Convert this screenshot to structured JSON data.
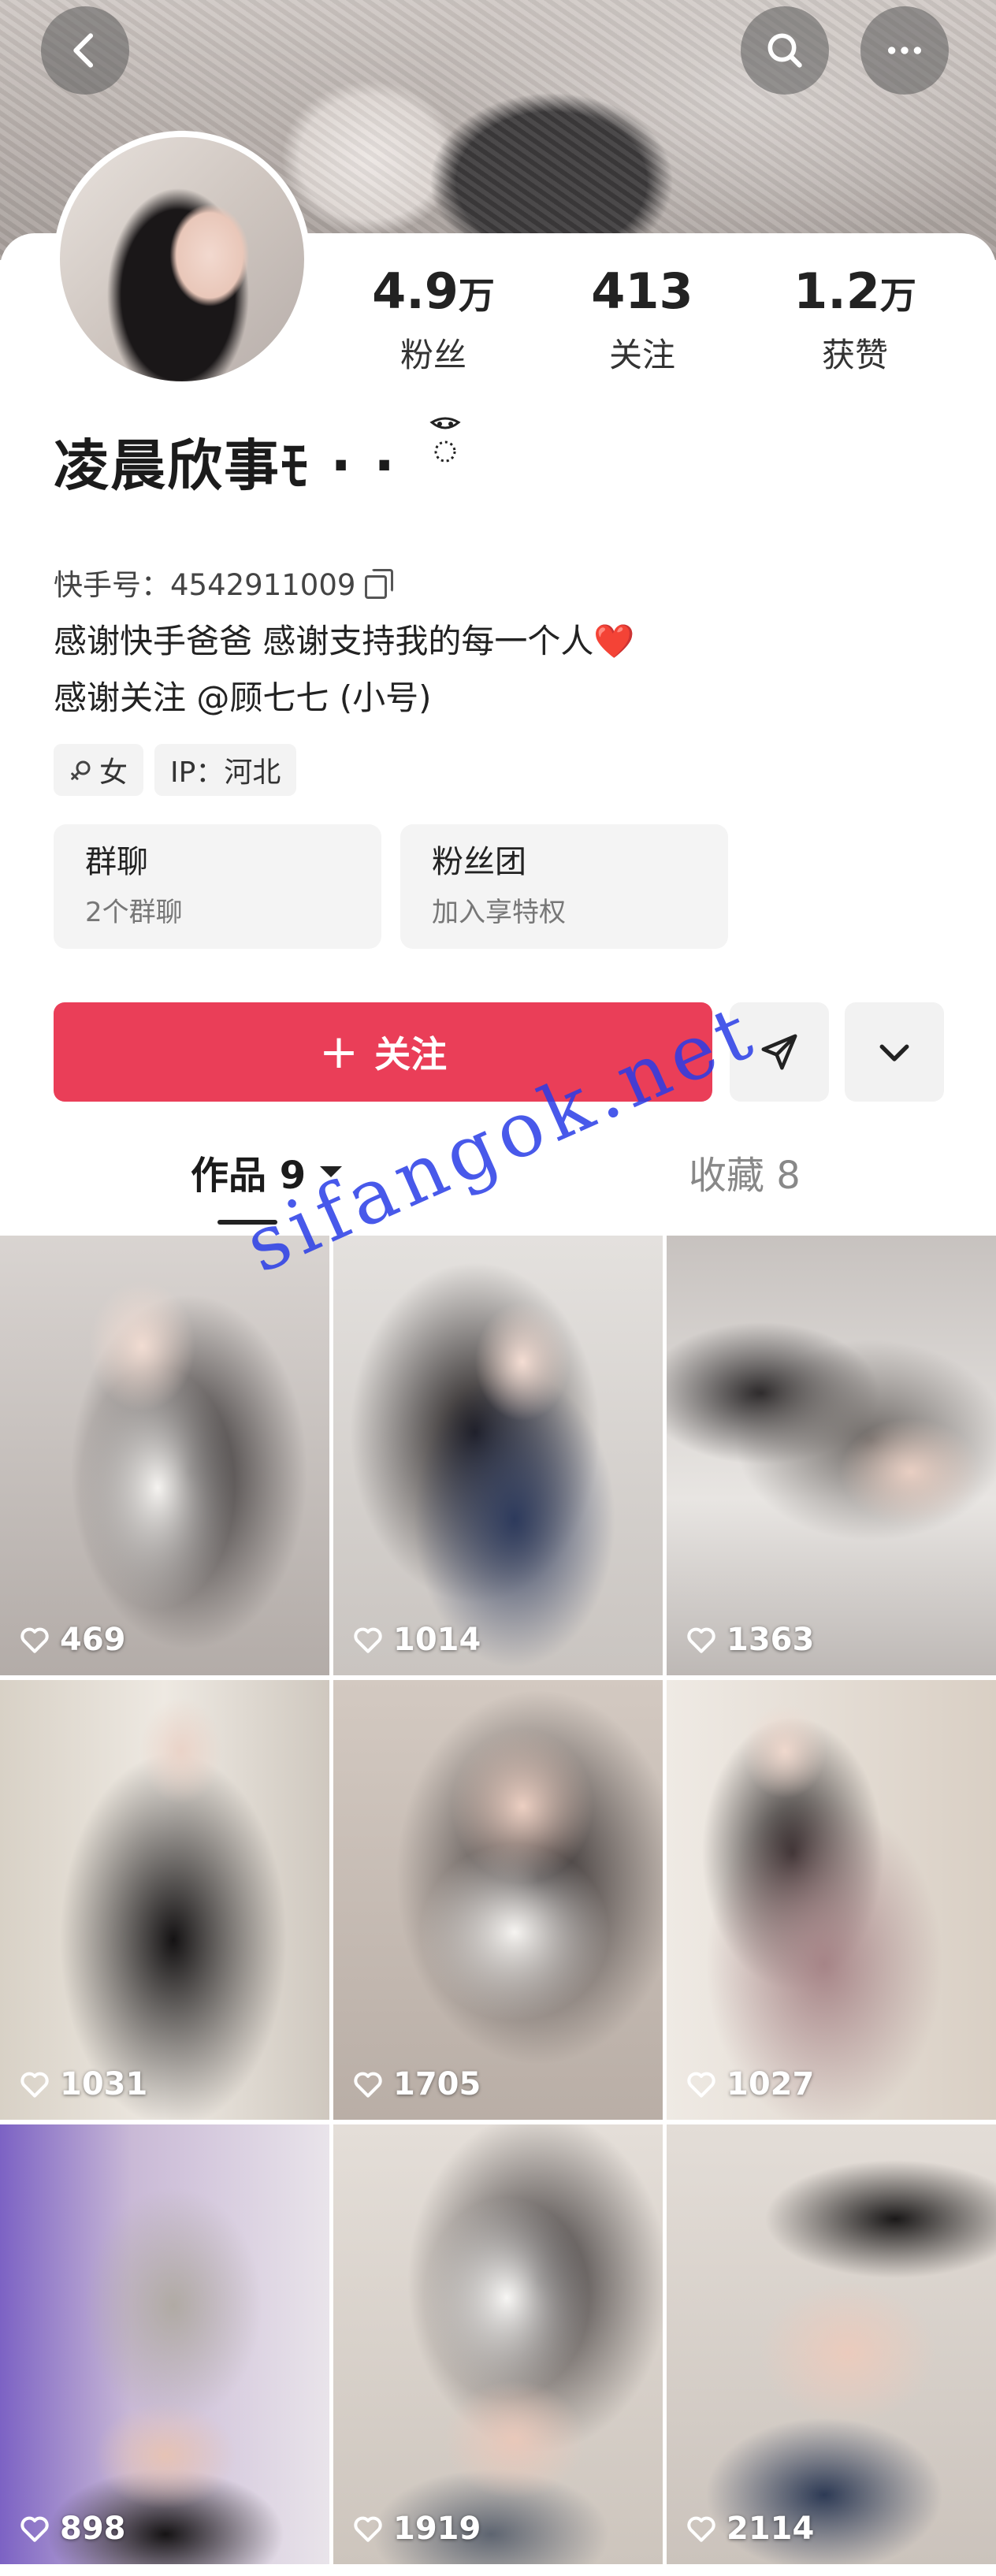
{
  "header": {
    "back_icon": "back-chevron-icon",
    "search_icon": "search-icon",
    "more_icon": "more-dots-icon"
  },
  "profile": {
    "name": "凌晨欣事ﾓ · ·",
    "kuaishou_id": "快手号：4542911009",
    "bio_line1": "感谢快手爸爸 感谢支持我的每一个人",
    "bio_heart": "❤️",
    "bio_line2": "感谢关注 @顾七七 (小号)"
  },
  "stats": [
    {
      "value": "4.9",
      "unit": "万",
      "label": "粉丝"
    },
    {
      "value": "413",
      "unit": "",
      "label": "关注"
    },
    {
      "value": "1.2",
      "unit": "万",
      "label": "获赞"
    }
  ],
  "tags": {
    "gender_icon": "female-icon",
    "gender": "女",
    "ip": "IP：河北"
  },
  "cards": [
    {
      "title": "群聊",
      "sub": "2个群聊"
    },
    {
      "title": "粉丝团",
      "sub": "加入享特权"
    }
  ],
  "actions": {
    "follow_label": "关注",
    "plus_icon": "plus-icon",
    "send_icon": "send-icon",
    "expand_icon": "chevron-down-icon"
  },
  "tabs": [
    {
      "label": "作品 9"
    },
    {
      "label": "收藏 8"
    }
  ],
  "posts": [
    {
      "likes": "469"
    },
    {
      "likes": "1014"
    },
    {
      "likes": "1363"
    },
    {
      "likes": "1031"
    },
    {
      "likes": "1705"
    },
    {
      "likes": "1027"
    },
    {
      "likes": "898"
    },
    {
      "likes": "1919"
    },
    {
      "likes": "2114"
    }
  ],
  "watermark": "sifangok.net",
  "colors": {
    "accent": "#ea3e58",
    "heart": "#e0323c",
    "watermark": "#2c3ce6"
  }
}
